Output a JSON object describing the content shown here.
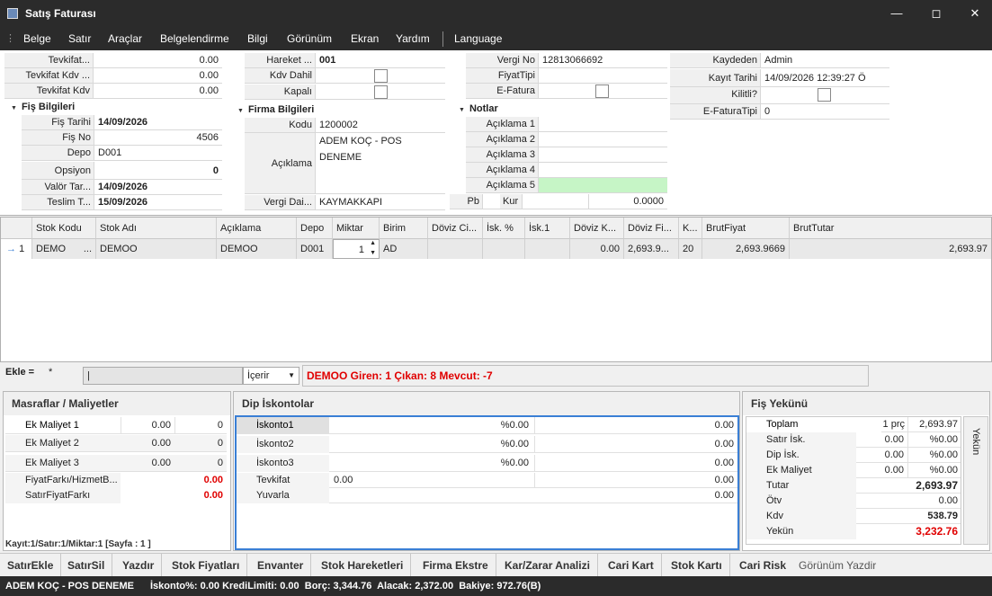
{
  "window": {
    "title": "Satış Faturası"
  },
  "menu": [
    "Belge",
    "Satır",
    "Araçlar",
    "Belgelendirme",
    "Bilgi",
    "Görünüm",
    "Ekran",
    "Yardım",
    "Language"
  ],
  "tevkifat": [
    {
      "label": "Tevkifat...",
      "value": "0.00"
    },
    {
      "label": "Tevkifat Kdv ...",
      "value": "0.00"
    },
    {
      "label": "Tevkifat Kdv",
      "value": "0.00"
    }
  ],
  "fis": {
    "section": "Fiş Bilgileri",
    "tarih_label": "Fiş Tarihi",
    "tarih": "14/09/2026",
    "no_label": "Fiş No",
    "no": "4506",
    "depo_label": "Depo",
    "depo": "D001",
    "opsiyon_label": "Opsiyon",
    "opsiyon": "0",
    "valor_label": "Valör Tar...",
    "valor": "14/09/2026",
    "teslim_label": "Teslim T...",
    "teslim": "15/09/2026"
  },
  "hareket": {
    "label": "Hareket ...",
    "value": "001",
    "kdv_label": "Kdv Dahil",
    "kapali_label": "Kapalı"
  },
  "firma": {
    "section": "Firma Bilgileri",
    "kodu_label": "Kodu",
    "kodu": "1200002",
    "aciklama_label": "Açıklama",
    "aciklama": "ADEM KOÇ - POS DENEME",
    "vergidai_label": "Vergi Dai...",
    "vergidai": "KAYMAKKAPI"
  },
  "vergi": {
    "no_label": "Vergi No",
    "no": "12813066692",
    "fiyattipi_label": "FiyatTipi",
    "efatura_label": "E-Fatura"
  },
  "notlar": {
    "section": "Notlar",
    "labels": [
      "Açıklama 1",
      "Açıklama 2",
      "Açıklama 3",
      "Açıklama 4",
      "Açıklama 5"
    ],
    "pb_label": "Pb",
    "kur_label": "Kur",
    "kur": "0.0000"
  },
  "kayit": {
    "kaydeden_label": "Kaydeden",
    "kaydeden": "Admin",
    "tarih_label": "Kayıt Tarihi",
    "tarih": "14/09/2026 12:39:27 Ö",
    "kilitli_label": "Kilitli?",
    "efaturatipi_label": "E-FaturaTipi",
    "efaturatipi": "0"
  },
  "grid": {
    "headers": [
      "Stok Kodu",
      "Stok Adı",
      "Açıklama",
      "Depo",
      "Miktar",
      "Birim",
      "Döviz Ci...",
      "İsk. %",
      "İsk.1",
      "Döviz K...",
      "Döviz Fi...",
      "K...",
      "BrutFiyat",
      "BrutTutar"
    ],
    "row": {
      "indicator": "→",
      "no": "1",
      "stok_kodu": "DEMO",
      "stok_adi": "DEMOO",
      "aciklama": "DEMOO",
      "depo": "D001",
      "miktar": "1",
      "birim": "AD",
      "doviz_k": "0.00",
      "doviz_fi": "2,693.9...",
      "k": "20",
      "brut_fiyat": "2,693.9669",
      "brut_tutar": "2,693.97"
    }
  },
  "ekle": {
    "label": "Ekle =",
    "star": "*",
    "combo": "İçerir",
    "message": "DEMOO Giren: 1 Çıkan: 8 Mevcut: -7"
  },
  "masraf": {
    "title": "Masraflar / Maliyetler",
    "rows": [
      {
        "label": "Ek Maliyet 1",
        "v1": "0.00",
        "v2": "0"
      },
      {
        "label": "Ek Maliyet 2",
        "v1": "0.00",
        "v2": "0"
      },
      {
        "label": "Ek Maliyet 3",
        "v1": "0.00",
        "v2": "0"
      }
    ],
    "fiyatfarki_label": "FiyatFarkı/HizmetB...",
    "fiyatfarki": "0.00",
    "satirfiyat_label": "SatırFiyatFarkı",
    "satirfiyat": "0.00",
    "footer": "Kayıt:1/Satır:1/Miktar:1 [Sayfa : 1 ]"
  },
  "dip": {
    "title": "Dip İskontolar",
    "rows": [
      {
        "label": "İskonto1",
        "pct": "%0.00",
        "val": "0.00"
      },
      {
        "label": "İskonto2",
        "pct": "%0.00",
        "val": "0.00"
      },
      {
        "label": "İskonto3",
        "pct": "%0.00",
        "val": "0.00"
      }
    ],
    "tevkifat_label": "Tevkifat",
    "tevkifat_mid": "0.00",
    "tevkifat_val": "0.00",
    "yuvarla_label": "Yuvarla",
    "yuvarla_val": "0.00"
  },
  "yekun": {
    "title": "Fiş Yekünü",
    "side": "Yekün",
    "toplam_label": "Toplam",
    "toplam_qty": "1 prç",
    "toplam": "2,693.97",
    "rows": [
      {
        "label": "Satır İsk.",
        "v1": "0.00",
        "v2": "%0.00"
      },
      {
        "label": "Dip İsk.",
        "v1": "0.00",
        "v2": "%0.00"
      },
      {
        "label": "Ek Maliyet",
        "v1": "0.00",
        "v2": "%0.00"
      }
    ],
    "tutar_label": "Tutar",
    "tutar": "2,693.97",
    "otv_label": "Ötv",
    "otv": "0.00",
    "kdv_label": "Kdv",
    "kdv": "538.79",
    "yekun_label": "Yekün",
    "yekun": "3,232.76"
  },
  "toolbar": [
    "SatırEkle",
    "SatırSil",
    "Yazdır",
    "Stok Fiyatları",
    "Envanter",
    "Stok Hareketleri",
    "Firma Ekstre",
    "Kar/Zarar Analizi",
    "Cari Kart",
    "Stok Kartı",
    "Cari Risk"
  ],
  "toolbar_extra": "Görünüm Yazdir",
  "status": {
    "firma": "ADEM KOÇ - POS DENEME",
    "info": "İskonto%: 0.00 KrediLimiti: 0.00  Borç: 3,344.76  Alacak: 2,372.00  Bakiye: 972.76(B)"
  }
}
